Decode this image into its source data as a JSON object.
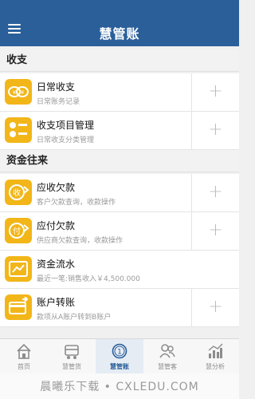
{
  "header": {
    "title": "慧管账",
    "menu_icon": "hamburger-menu-icon"
  },
  "sections": [
    {
      "title": "收支"
    },
    {
      "title": "资金往来"
    }
  ],
  "rows": [
    {
      "title": "日常收支",
      "subtitle": "日常账务记录",
      "icon": "daily-ledger-icon",
      "action": "+"
    },
    {
      "title": "收支项目管理",
      "subtitle": "日常收支分类管理",
      "icon": "category-manage-icon",
      "action": "+"
    },
    {
      "title": "应收欠款",
      "subtitle": "客户欠款查询，收款操作",
      "icon": "receivable-icon",
      "action": "+"
    },
    {
      "title": "应付欠款",
      "subtitle": "供应商欠款查询，收款操作",
      "icon": "payable-icon",
      "action": "+"
    },
    {
      "title": "资金流水",
      "subtitle": "最近一笔:销售收入￥4,500.000",
      "icon": "cash-flow-icon",
      "action": ""
    },
    {
      "title": "账户转账",
      "subtitle": "款项从A账户转到B账户",
      "icon": "account-transfer-icon",
      "action": "+"
    }
  ],
  "tabs": [
    {
      "label": "首页",
      "icon": "home-icon",
      "active": false
    },
    {
      "label": "慧管货",
      "icon": "goods-icon",
      "active": false
    },
    {
      "label": "慧管账",
      "icon": "account-icon",
      "active": true
    },
    {
      "label": "慧管客",
      "icon": "customers-icon",
      "active": false
    },
    {
      "label": "慧分析",
      "icon": "analysis-icon",
      "active": false
    }
  ],
  "watermark": "晨曦乐下载 • CXLEDU.COM",
  "colors": {
    "header_bg": "#2a5f9a",
    "icon_bg": "#f2b619",
    "active_tab": "#2a5f9a"
  }
}
